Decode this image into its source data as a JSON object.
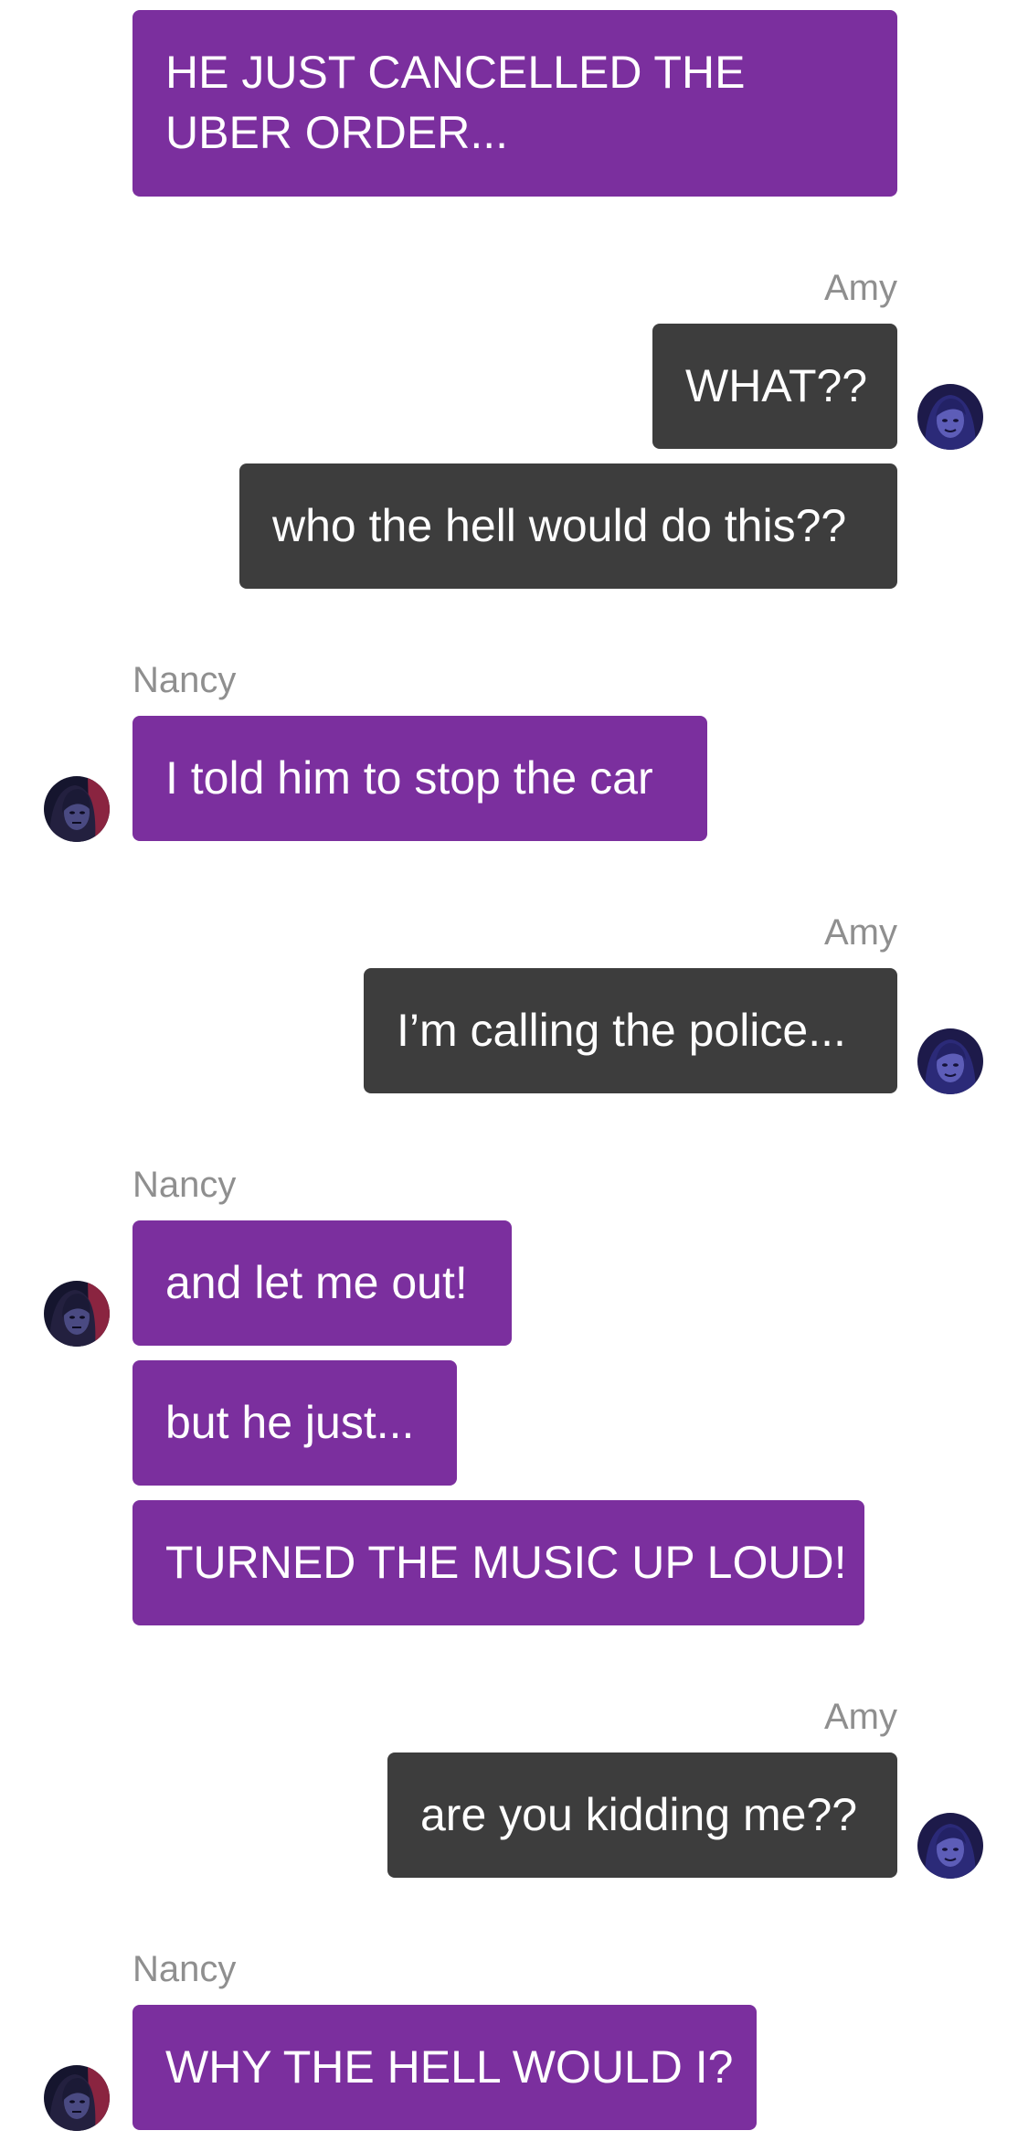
{
  "colors": {
    "nancy_bubble": "#7b2f9e",
    "amy_bubble": "#3d3d3d",
    "sender_name": "#8f8f8f",
    "background": "#ffffff"
  },
  "messages": [
    {
      "sender": "Nancy",
      "text": "HE JUST CANCELLED THE UBER ORDER..."
    },
    {
      "sender": "Amy",
      "name_label": "Amy",
      "text": "WHAT??"
    },
    {
      "sender": "Amy",
      "text": "who the hell would do this??"
    },
    {
      "sender": "Nancy",
      "name_label": "Nancy",
      "text": "I told him to stop the car"
    },
    {
      "sender": "Amy",
      "name_label": "Amy",
      "text": "I’m calling the police..."
    },
    {
      "sender": "Nancy",
      "name_label": "Nancy",
      "text": "and let me out!"
    },
    {
      "sender": "Nancy",
      "text": "but he just..."
    },
    {
      "sender": "Nancy",
      "text": "TURNED THE MUSIC UP LOUD!"
    },
    {
      "sender": "Amy",
      "name_label": "Amy",
      "text": "are you kidding me??"
    },
    {
      "sender": "Nancy",
      "name_label": "Nancy",
      "text": "WHY THE HELL WOULD I?"
    }
  ],
  "avatars": {
    "amy": "amy-avatar-icon",
    "nancy": "nancy-avatar-icon"
  }
}
